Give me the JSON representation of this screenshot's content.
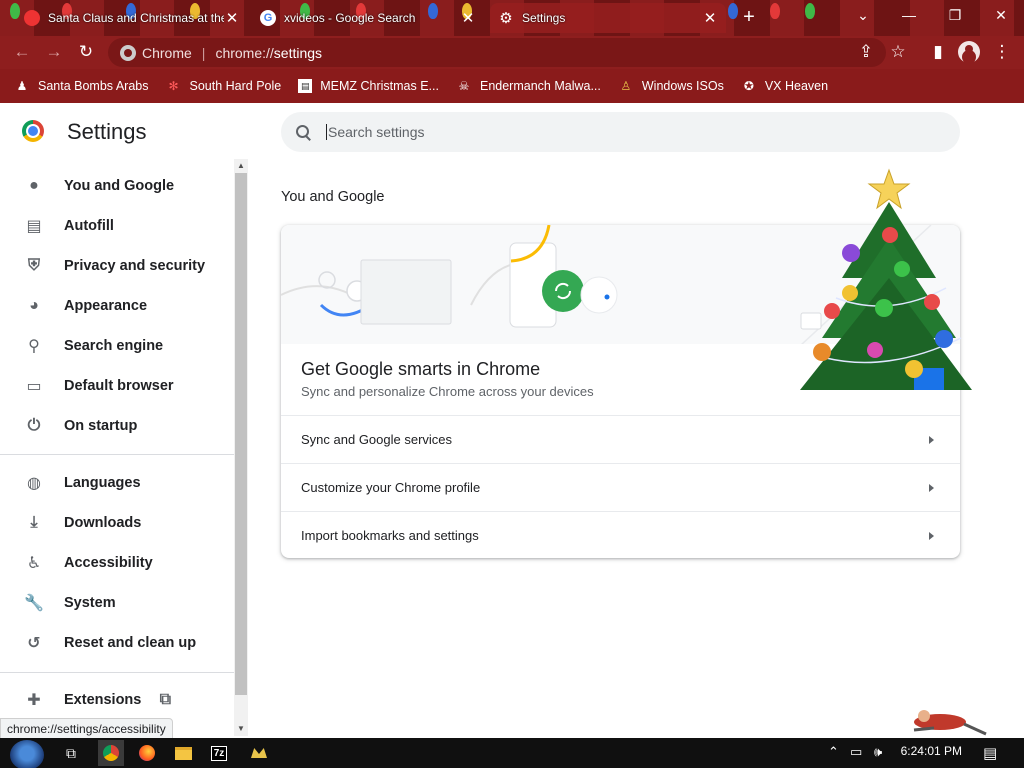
{
  "tabs": [
    {
      "title": "Santa Claus and Christmas at the",
      "close": "✕"
    },
    {
      "title": "xvideos - Google Search",
      "close": "✕"
    },
    {
      "title": "Settings",
      "close": "✕"
    }
  ],
  "new_tab": "+",
  "window_controls": {
    "tab_search": "⌄",
    "minimize": "—",
    "restore": "❐",
    "close": "✕"
  },
  "toolbar": {
    "back": "←",
    "forward": "→",
    "reload": "↻",
    "share": "⇪",
    "star": "☆",
    "side_panel": "▮",
    "menu": "⋮"
  },
  "omnibox": {
    "site_label": "Chrome",
    "url_scheme": "chrome://",
    "url_path": "settings"
  },
  "bookmarks": [
    {
      "label": "Santa Bombs Arabs",
      "icon": "santa-icon"
    },
    {
      "label": "South Hard Pole",
      "icon": "snowflake-icon"
    },
    {
      "label": "MEMZ Christmas E...",
      "icon": "page-icon"
    },
    {
      "label": "Endermanch Malwa...",
      "icon": "skull-icon"
    },
    {
      "label": "Windows ISOs",
      "icon": "figure-icon"
    },
    {
      "label": "VX Heaven",
      "icon": "vx-icon"
    }
  ],
  "settings": {
    "title": "Settings",
    "search_placeholder": "Search settings"
  },
  "sidebar": {
    "items": [
      {
        "label": "You and Google",
        "icon": "person-icon"
      },
      {
        "label": "Autofill",
        "icon": "clipboard-icon"
      },
      {
        "label": "Privacy and security",
        "icon": "shield-icon"
      },
      {
        "label": "Appearance",
        "icon": "palette-icon"
      },
      {
        "label": "Search engine",
        "icon": "search-icon"
      },
      {
        "label": "Default browser",
        "icon": "browser-icon"
      },
      {
        "label": "On startup",
        "icon": "power-icon"
      },
      {
        "label": "Languages",
        "icon": "globe-icon"
      },
      {
        "label": "Downloads",
        "icon": "download-icon"
      },
      {
        "label": "Accessibility",
        "icon": "accessibility-icon"
      },
      {
        "label": "System",
        "icon": "wrench-icon"
      },
      {
        "label": "Reset and clean up",
        "icon": "history-icon"
      },
      {
        "label": "Extensions",
        "icon": "puzzle-icon"
      }
    ]
  },
  "main": {
    "section_title": "You and Google",
    "card": {
      "title": "Get Google smarts in Chrome",
      "subtitle": "Sync and personalize Chrome across your devices",
      "rows": [
        {
          "label": "Sync and Google services"
        },
        {
          "label": "Customize your Chrome profile"
        },
        {
          "label": "Import bookmarks and settings"
        }
      ]
    }
  },
  "status_bubble": "chrome://settings/accessibility",
  "taskbar": {
    "apps": [
      "windows-icon",
      "chrome-icon",
      "firefox-icon",
      "explorer-icon",
      "7zip-icon",
      "app-icon"
    ],
    "sevenzip_label": "7z",
    "clock": "6:24:01 PM"
  },
  "colors": {
    "frame": "#8e1e1e",
    "accent_blue": "#1a73e8",
    "green": "#34a853"
  }
}
